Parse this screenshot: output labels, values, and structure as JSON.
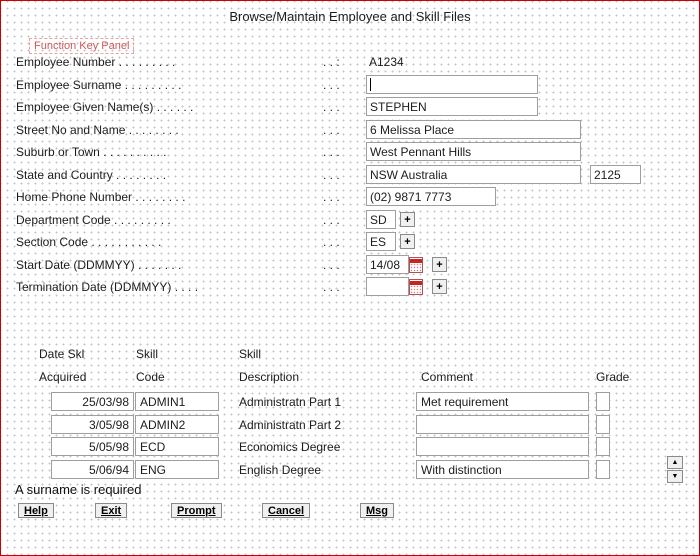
{
  "title": "Browse/Maintain Employee and Skill Files",
  "function_key_panel": "Function Key Panel",
  "message": "A surname is required",
  "fields": {
    "employee_number": {
      "label": "Employee Number . . . . . . . . .",
      "dots": ". . :",
      "value": "A1234"
    },
    "employee_surname": {
      "label": "Employee Surname . . . . . . . . .",
      "dots": ". . .",
      "value": ""
    },
    "employee_given_names": {
      "label": "Employee Given Name(s) . . . . . .",
      "dots": ". . .",
      "value": "STEPHEN"
    },
    "street": {
      "label": "Street No and Name . . . . . . . .",
      "dots": ". . .",
      "value": "6 Melissa Place"
    },
    "suburb": {
      "label": "Suburb or Town . . . . . . . . . .",
      "dots": ". . .",
      "value": "West Pennant Hills"
    },
    "state_country": {
      "label": "State and Country . . . . . . . .",
      "dots": ". . .",
      "value": "NSW Australia",
      "postcode": "2125"
    },
    "home_phone": {
      "label": "Home Phone Number . . . . . . . .",
      "dots": ". . .",
      "value": "(02) 9871 7773"
    },
    "department_code": {
      "label": "Department Code . . . . . . . . .",
      "dots": ". . .",
      "value": "SD"
    },
    "section_code": {
      "label": "Section Code . . . . . . . . . . .",
      "dots": ". . .",
      "value": "ES"
    },
    "start_date": {
      "label": "Start Date (DDMMYY) . . . . . . .",
      "dots": ". . .",
      "value": "14/08"
    },
    "termination_date": {
      "label": "Termination Date (DDMMYY) . . . .",
      "dots": ". . .",
      "value": ""
    }
  },
  "skills": {
    "headers": {
      "h_date1": "Date Skl",
      "h_date2": "Acquired",
      "h_code1": "Skill",
      "h_code2": "Code",
      "h_desc1": "Skill",
      "h_desc2": "Description",
      "h_comment": "Comment",
      "h_grade": "Grade"
    },
    "rows": [
      {
        "date": "25/03/98",
        "code": "ADMIN1",
        "description": "Administratn Part 1",
        "comment": "Met requirement",
        "grade": ""
      },
      {
        "date": "3/05/98",
        "code": "ADMIN2",
        "description": "Administratn Part 2",
        "comment": "",
        "grade": ""
      },
      {
        "date": "5/05/98",
        "code": "ECD",
        "description": "Economics Degree",
        "comment": "",
        "grade": ""
      },
      {
        "date": "5/06/94",
        "code": "ENG",
        "description": "English Degree",
        "comment": "With distinction",
        "grade": ""
      }
    ]
  },
  "buttons": {
    "help": "Help",
    "exit": "Exit",
    "prompt": "Prompt",
    "cancel": "Cancel",
    "msg": "Msg"
  },
  "icons": {
    "plus": "+",
    "scroll_up": "▲",
    "scroll_down": "▼"
  },
  "colors": {
    "frame_border": "#cc0000",
    "panel_text": "#cc5a5a",
    "calendar_red": "#cc2222"
  }
}
